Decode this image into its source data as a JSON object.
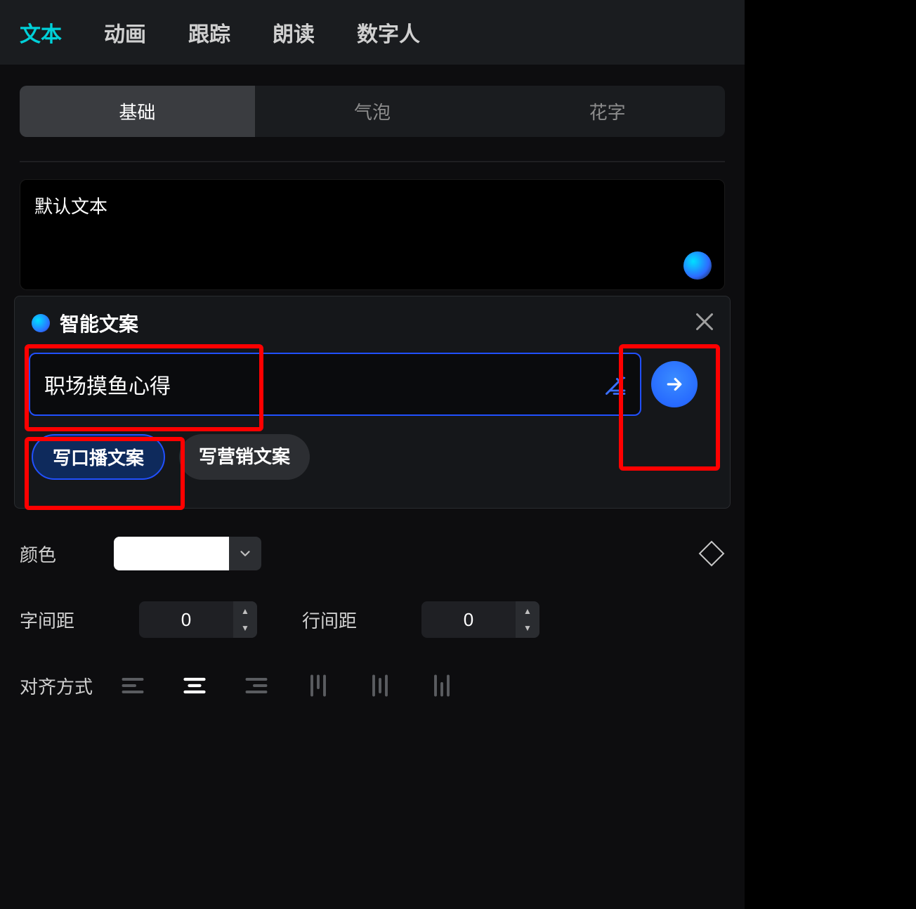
{
  "topTabs": {
    "text": "文本",
    "animation": "动画",
    "tracking": "跟踪",
    "narration": "朗读",
    "digitalHuman": "数字人"
  },
  "subTabs": {
    "basic": "基础",
    "bubble": "气泡",
    "artText": "花字"
  },
  "textarea": {
    "value": "默认文本"
  },
  "smartCopy": {
    "title": "智能文案",
    "inputValue": "职场摸鱼心得",
    "chipBroadcast": "写口播文案",
    "chipMarketing": "写营销文案"
  },
  "props": {
    "colorLabel": "颜色",
    "colorValue": "#ffffff",
    "charSpacingLabel": "字间距",
    "charSpacingValue": "0",
    "lineSpacingLabel": "行间距",
    "lineSpacingValue": "0",
    "alignLabel": "对齐方式"
  }
}
